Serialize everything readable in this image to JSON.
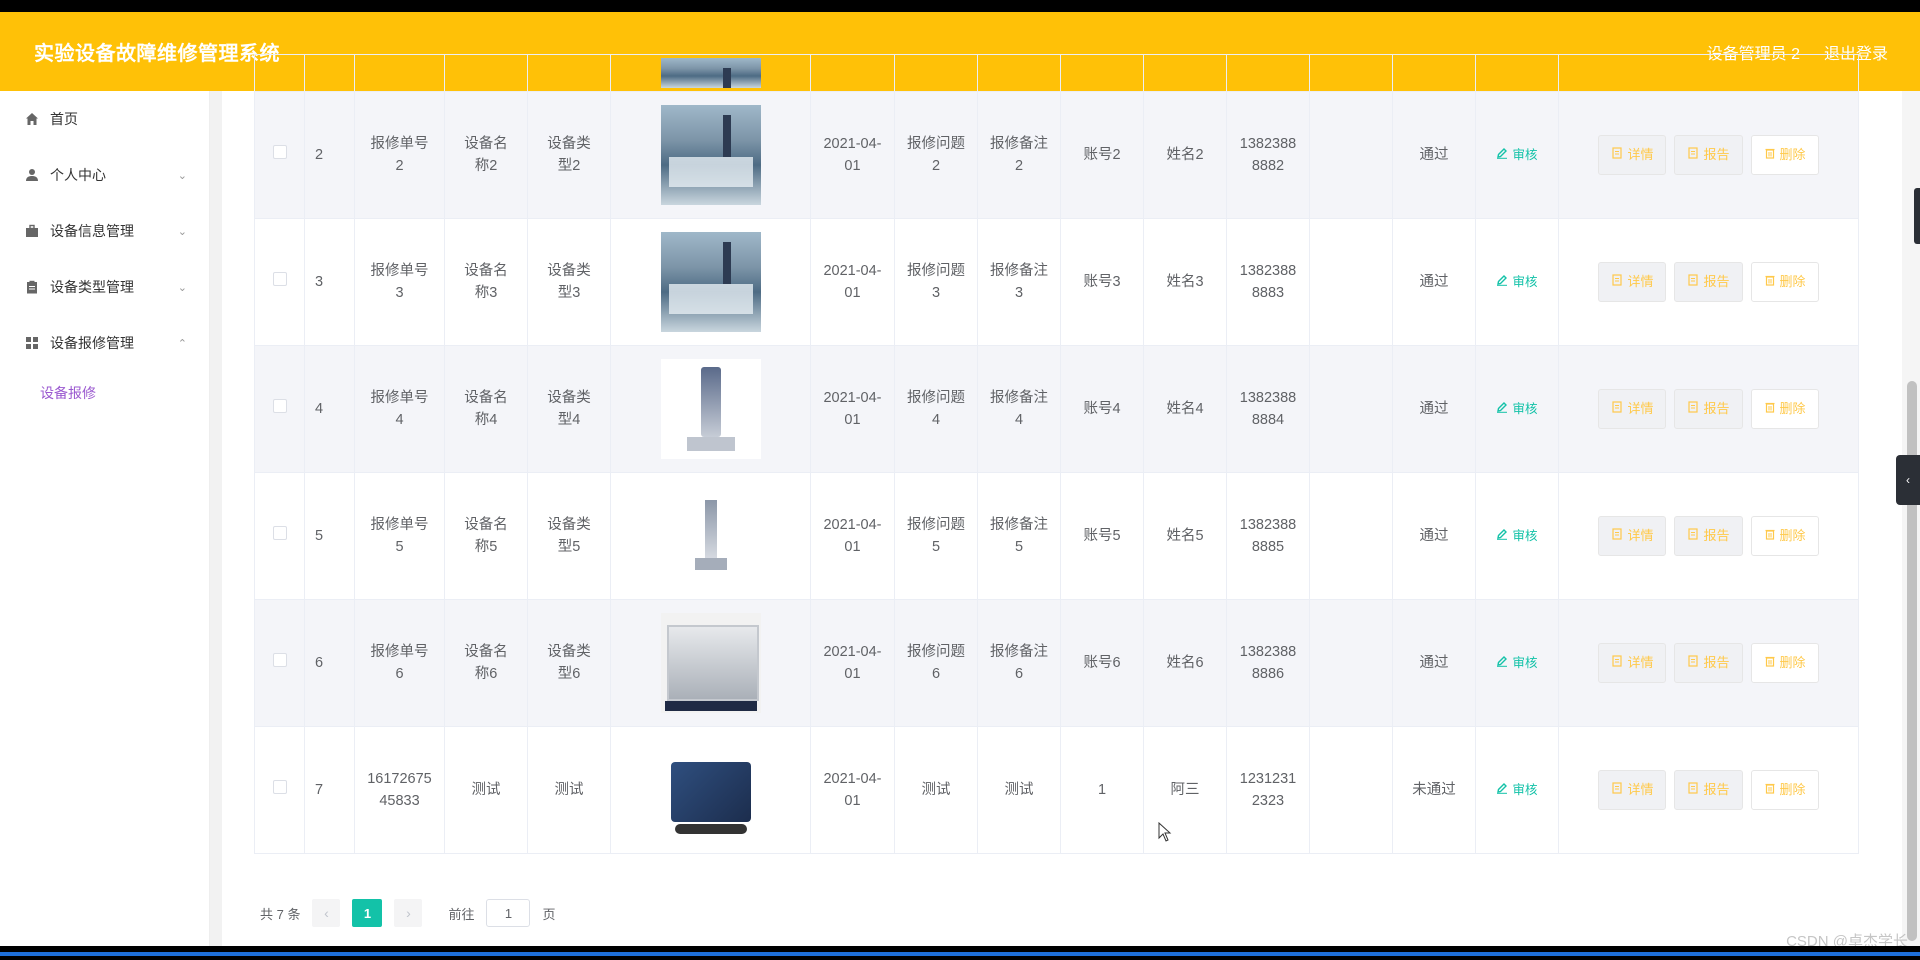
{
  "header": {
    "title": "实验设备故障维修管理系统",
    "user": "设备管理员 2",
    "logout": "退出登录"
  },
  "sidebar": {
    "items": [
      {
        "label": "首页",
        "icon": "home-icon"
      },
      {
        "label": "个人中心",
        "icon": "person-icon"
      },
      {
        "label": "设备信息管理",
        "icon": "briefcase-icon"
      },
      {
        "label": "设备类型管理",
        "icon": "clipboard-icon"
      },
      {
        "label": "设备报修管理",
        "icon": "grid-icon"
      }
    ],
    "sub_item": "设备报修"
  },
  "table": {
    "audit_label": "审核",
    "buttons": {
      "detail": "详情",
      "report": "报告",
      "delete": "删除"
    },
    "rows": [
      {
        "index": "2",
        "order_no": "报修单号2",
        "device_name": "设备名称2",
        "device_type": "设备类型2",
        "date": "2021-04-01",
        "issue": "报修问题2",
        "remark": "报修备注2",
        "account": "账号2",
        "name": "姓名2",
        "phone": "13823888882",
        "status": "通过",
        "image": "lab-room"
      },
      {
        "index": "3",
        "order_no": "报修单号3",
        "device_name": "设备名称3",
        "device_type": "设备类型3",
        "date": "2021-04-01",
        "issue": "报修问题3",
        "remark": "报修备注3",
        "account": "账号3",
        "name": "姓名3",
        "phone": "13823888883",
        "status": "通过",
        "image": "lab-room"
      },
      {
        "index": "4",
        "order_no": "报修单号4",
        "device_name": "设备名称4",
        "device_type": "设备类型4",
        "date": "2021-04-01",
        "issue": "报修问题4",
        "remark": "报修备注4",
        "account": "账号4",
        "name": "姓名4",
        "phone": "13823888884",
        "status": "通过",
        "image": "press"
      },
      {
        "index": "5",
        "order_no": "报修单号5",
        "device_name": "设备名称5",
        "device_type": "设备类型5",
        "date": "2021-04-01",
        "issue": "报修问题5",
        "remark": "报修备注5",
        "account": "账号5",
        "name": "姓名5",
        "phone": "13823888885",
        "status": "通过",
        "image": "post"
      },
      {
        "index": "6",
        "order_no": "报修单号6",
        "device_name": "设备名称6",
        "device_type": "设备类型6",
        "date": "2021-04-01",
        "issue": "报修问题6",
        "remark": "报修备注6",
        "account": "账号6",
        "name": "姓名6",
        "phone": "13823888886",
        "status": "通过",
        "image": "tank"
      },
      {
        "index": "7",
        "order_no": "1617267545833",
        "device_name": "测试",
        "device_type": "测试",
        "date": "2021-04-01",
        "issue": "测试",
        "remark": "测试",
        "account": "1",
        "name": "阿三",
        "phone": "12312312323",
        "status": "未通过",
        "image": "machine"
      }
    ]
  },
  "pagination": {
    "total": "共 7 条",
    "current_page": "1",
    "goto_prefix": "前往",
    "goto_value": "1",
    "goto_suffix": "页"
  },
  "watermark": "CSDN @卓杰学长",
  "colors": {
    "header": "#ffc107",
    "accent": "#13c2a8",
    "button_text": "#ffc94a",
    "submenu_active": "#9b59d0"
  }
}
